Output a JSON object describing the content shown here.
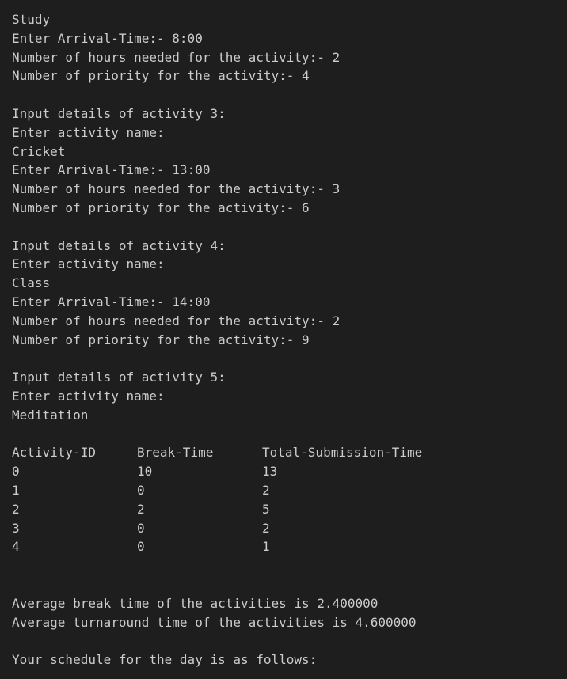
{
  "lines_top": [
    "Study",
    "Enter Arrival-Time:- 8:00",
    "Number of hours needed for the activity:- 2",
    "Number of priority for the activity:- 4",
    "",
    "Input details of activity 3:",
    "Enter activity name:",
    "Cricket",
    "Enter Arrival-Time:- 13:00",
    "Number of hours needed for the activity:- 3",
    "Number of priority for the activity:- 6",
    "",
    "Input details of activity 4:",
    "Enter activity name:",
    "Class",
    "Enter Arrival-Time:- 14:00",
    "Number of hours needed for the activity:- 2",
    "Number of priority for the activity:- 9",
    "",
    "Input details of activity 5:",
    "Enter activity name:",
    "Meditation",
    ""
  ],
  "table": {
    "headers": [
      "Activity-ID",
      "Break-Time",
      "Total-Submission-Time"
    ],
    "rows": [
      [
        "0",
        "10",
        "13"
      ],
      [
        "1",
        "0",
        "2"
      ],
      [
        "2",
        "2",
        "5"
      ],
      [
        "3",
        "0",
        "2"
      ],
      [
        "4",
        "0",
        "1"
      ]
    ]
  },
  "lines_bottom": [
    "",
    "",
    "Average break time of the activities is 2.400000",
    "Average turnaround time of the activities is 4.600000",
    "",
    "Your schedule for the day is as follows:"
  ]
}
